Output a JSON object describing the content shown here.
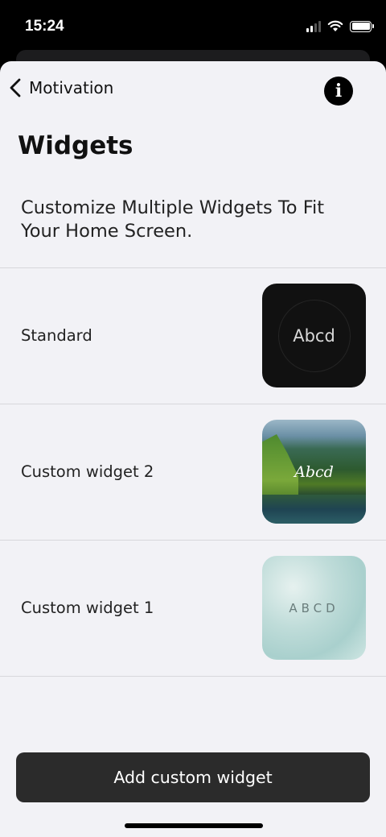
{
  "status_bar": {
    "time": "15:24"
  },
  "nav": {
    "back_label": "Motivation",
    "info_symbol": "i"
  },
  "page": {
    "title": "Widgets",
    "description": "Customize Multiple Widgets To Fit Your Home Screen."
  },
  "widgets": [
    {
      "label": "Standard",
      "preview_text": "Abcd"
    },
    {
      "label": "Custom widget 2",
      "preview_text": "Abcd"
    },
    {
      "label": "Custom widget 1",
      "preview_text": "ABCD"
    }
  ],
  "actions": {
    "add_label": "Add custom widget"
  },
  "icons": {
    "back": "chevron-left-icon",
    "info": "info-icon",
    "signal": "cellular-signal-icon",
    "wifi": "wifi-icon",
    "battery": "battery-icon"
  }
}
